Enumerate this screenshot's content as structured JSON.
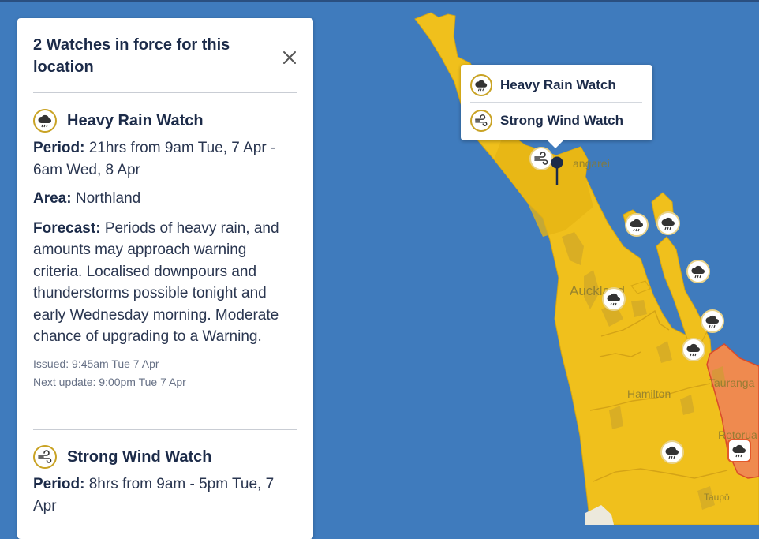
{
  "panel": {
    "title": "2 Watches in force for this location",
    "close_icon": "close-icon"
  },
  "watches": [
    {
      "icon": "rain-cloud-icon",
      "name": "Heavy Rain Watch",
      "period_label": "Period:",
      "period": "21hrs from 9am Tue, 7 Apr - 6am Wed, 8 Apr",
      "area_label": "Area:",
      "area": "Northland",
      "forecast_label": "Forecast:",
      "forecast": "Periods of heavy rain, and amounts may approach warning criteria. Localised downpours and thunderstorms possible tonight and early Wednesday morning. Moderate chance of upgrading to a Warning.",
      "issued": "Issued: 9:45am Tue 7 Apr",
      "next_update": "Next update: 9:00pm Tue 7 Apr"
    },
    {
      "icon": "wind-icon",
      "name": "Strong Wind Watch",
      "period_label": "Period:",
      "period": "8hrs from 9am - 5pm Tue, 7 Apr"
    }
  ],
  "popup": {
    "items": [
      {
        "icon": "rain-cloud-icon",
        "label": "Heavy Rain Watch"
      },
      {
        "icon": "wind-icon",
        "label": "Strong Wind Watch"
      }
    ]
  },
  "map": {
    "labels": {
      "whangarei": "angarei",
      "auckland": "Auckland",
      "hamilton": "Hamilton",
      "tauranga": "Tauranga",
      "rotorua": "Rotorua",
      "taupo": "Taupō"
    },
    "colors": {
      "sea": "#3f7bbd",
      "watch_yellow": "#f2c21a",
      "watch_yellow_dark": "#e3b516",
      "warning_orange": "#ef8a4f",
      "land_texture": "#c9a52c"
    }
  }
}
